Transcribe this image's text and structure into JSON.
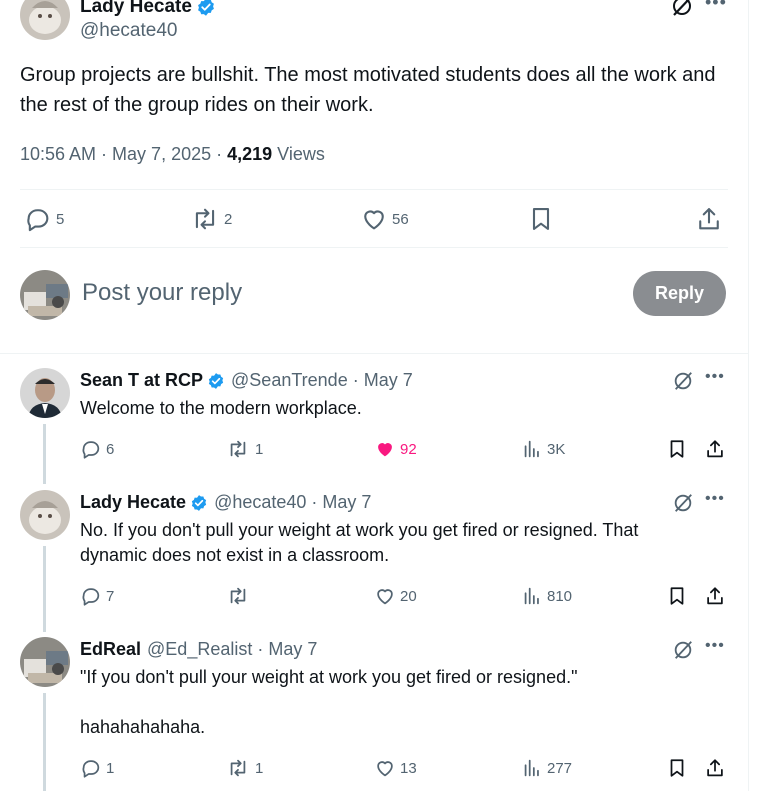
{
  "main_tweet": {
    "name": "Lady Hecate",
    "handle": "@hecate40",
    "text": "Group projects are bullshit.  The most motivated students does all the work and the rest of the group rides on their work.",
    "time": "10:56 AM · May 7, 2025 · ",
    "views_count": "4,219",
    "views_label": " Views",
    "replies": "5",
    "reposts": "2",
    "likes": "56"
  },
  "composer": {
    "placeholder": "Post your reply",
    "reply_label": "Reply"
  },
  "replies": [
    {
      "name": "Sean T at RCP",
      "handle": "@SeanTrende · May 7",
      "text": "Welcome to the modern workplace.",
      "replies": "6",
      "reposts": "1",
      "likes": "92",
      "liked": true,
      "views": "3K"
    },
    {
      "name": "Lady Hecate",
      "handle": "@hecate40 · May 7",
      "text": "No.  If you don't pull your weight at work you get fired or resigned.  That dynamic does not exist in a classroom.",
      "replies": "7",
      "reposts": "",
      "likes": "20",
      "liked": false,
      "views": "810"
    },
    {
      "name": "EdReal",
      "handle": "@Ed_Realist · May 7",
      "text_line1": "\"If you don't pull your weight at work you get fired or resigned.\"",
      "text_line2": "hahahahahaha.",
      "replies": "1",
      "reposts": "1",
      "likes": "13",
      "liked": false,
      "views": "277"
    }
  ],
  "colors": {
    "verified": "#1d9bf0",
    "like_active": "#f91880",
    "secondary": "#536471",
    "reply_button": "#8a8d91"
  }
}
